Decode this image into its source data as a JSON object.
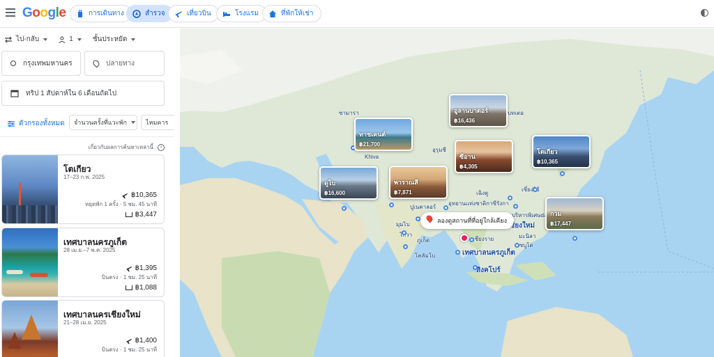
{
  "header": {
    "logo": "Google",
    "tabs": [
      {
        "label": "การเดินทาง",
        "icon": "travel-bag-icon",
        "active": false
      },
      {
        "label": "สำรวจ",
        "icon": "explore-icon",
        "active": true
      },
      {
        "label": "เที่ยวบิน",
        "icon": "flight-icon",
        "active": false
      },
      {
        "label": "โรงแรม",
        "icon": "hotel-icon",
        "active": false
      },
      {
        "label": "ที่พักให้เช่า",
        "icon": "home-icon",
        "active": false
      }
    ]
  },
  "search": {
    "trip_type": "ไป-กลับ",
    "passengers": "1",
    "cabin_class": "ชั้นประหยัด",
    "origin": "กรุงเทพมหานคร",
    "destination_placeholder": "ปลายทาง",
    "dates": "ทริป 1 สัปดาห์ใน 6 เดือนถัดไป"
  },
  "filters": {
    "all_label": "ตัวกรองทั้งหมด",
    "stops_label": "จำนวนครั้งที่แวะพัก",
    "interests_label": "ไหมคาร"
  },
  "about_results": "เกี่ยวกับผลการค้นหาเหล่านี้",
  "results": [
    {
      "city": "โตเกียว",
      "dates": "17–23 ก.พ. 2025",
      "flight_price": "฿10,365",
      "stops": "หยุดพัก 1 ครั้ง · 5 ชม. 45 นาที",
      "hotel_price": "฿3,447"
    },
    {
      "city": "เทศบาลนครภูเก็ต",
      "dates": "28 เม.ย.–7 พ.ค. 2025",
      "flight_price": "฿1,395",
      "stops": "บินตรง · 1 ชม. 25 นาที",
      "hotel_price": "฿1,088"
    },
    {
      "city": "เทศบาลนครเชียงใหม่",
      "dates": "21–28 เม.ย. 2025",
      "flight_price": "฿1,400",
      "stops": "บินตรง · 1 ชม. 25 นาที",
      "hotel_price": ""
    }
  ],
  "map": {
    "destinations": [
      {
        "name": "อูลานบาตอร์",
        "price": "฿16,436"
      },
      {
        "name": "ทาชเคนต์",
        "price": "฿21,700"
      },
      {
        "name": "ซีอาน",
        "price": "฿4,305"
      },
      {
        "name": "โตเกียว",
        "price": "฿10,365"
      },
      {
        "name": "ดูไบ",
        "price": "฿16,600"
      },
      {
        "name": "พาราณสี",
        "price": "฿7,871"
      },
      {
        "name": "กวม",
        "price": "฿17,447"
      }
    ],
    "labels": [
      "ซามารา",
      "Khiva",
      "อุรุมชี",
      "เฉิงตู",
      "เซี่ยงไฮ้",
      "อุทยานแห่งชาติกาซีรังกา",
      "เชียงใหม่",
      "เชียงราย",
      "มะนิลา",
      "เซบูโต",
      "ภูเก็ต",
      "โคลัมโบ",
      "เทศบาลนครภูเก็ต",
      "สิงคโปร์",
      "มุมไบ",
      "โกวา",
      "ปูเนคาลอร์",
      "ชมบริหารพิเศษฮ่อ",
      "บทเตอ"
    ],
    "tip": "ลองดูสถานที่ที่อยู่ใกล้เคียง"
  }
}
